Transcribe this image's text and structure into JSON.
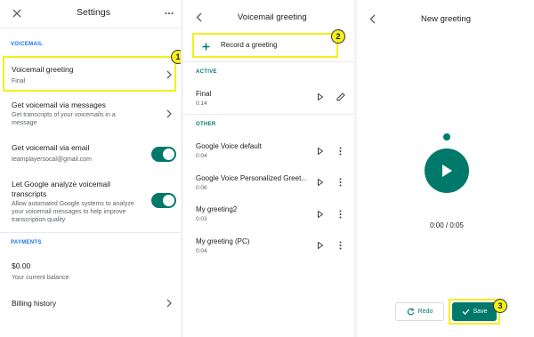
{
  "settings": {
    "title": "Settings",
    "voicemail_section": "VOICEMAIL",
    "voicemail_greeting": {
      "title": "Voicemail greeting",
      "sub": "Final"
    },
    "via_messages": {
      "title": "Get voicemail via messages",
      "sub": "Get transcripts of your voicemails in a message"
    },
    "via_email": {
      "title": "Get voicemail via email",
      "sub": "teamplayersocal@gmail.com",
      "enabled": true
    },
    "analyze": {
      "title": "Let Google analyze voicemail transcripts",
      "sub": "Allow automated Google systems to analyze your voicemail messages to help improve transcription quality",
      "enabled": true
    },
    "payments_section": "PAYMENTS",
    "balance": {
      "amount": "$0.00",
      "sub": "Your current balance"
    },
    "billing": {
      "title": "Billing history"
    }
  },
  "voicemail_greeting": {
    "title": "Voicemail greeting",
    "record_label": "Record a greeting",
    "active_section": "ACTIVE",
    "active": {
      "name": "Final",
      "duration": "0:14"
    },
    "other_section": "OTHER",
    "others": [
      {
        "name": "Google Voice default",
        "duration": "0:04"
      },
      {
        "name": "Google Voice Personalized Greet...",
        "duration": "0:06"
      },
      {
        "name": "My greeting2",
        "duration": "0:03"
      },
      {
        "name": "My greeting (PC)",
        "duration": "0:04"
      }
    ]
  },
  "new_greeting": {
    "title": "New greeting",
    "time": "0:00 / 0:05",
    "redo_label": "Redo",
    "save_label": "Save"
  },
  "callouts": {
    "one": "1",
    "two": "2",
    "three": "3"
  },
  "colors": {
    "accent": "#00796b",
    "highlight": "#f4f01a",
    "section_label": "#1a73e8"
  }
}
